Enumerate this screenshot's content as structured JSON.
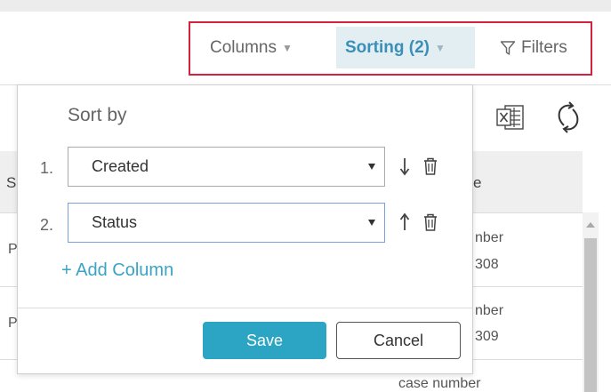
{
  "toolbar": {
    "columns_label": "Columns",
    "sorting_label": "Sorting (2)",
    "filters_label": "Filters"
  },
  "grid": {
    "header_left_fragment": "S",
    "header_right_fragment": "e",
    "rows": [
      {
        "left": "P",
        "line1": "nber",
        "line2": "308"
      },
      {
        "left": "P",
        "line1": "nber",
        "line2": "309"
      },
      {
        "line1": "case number"
      }
    ]
  },
  "sort_panel": {
    "title": "Sort by",
    "rules": [
      {
        "index": "1.",
        "field": "Created",
        "direction": "down"
      },
      {
        "index": "2.",
        "field": "Status",
        "direction": "up"
      }
    ],
    "add_column_label": "+ Add Column",
    "save_label": "Save",
    "cancel_label": "Cancel"
  },
  "colors": {
    "accent": "#2ba5c3",
    "sorting_active_bg": "#e3eef3",
    "highlight_border": "#d6213e"
  }
}
